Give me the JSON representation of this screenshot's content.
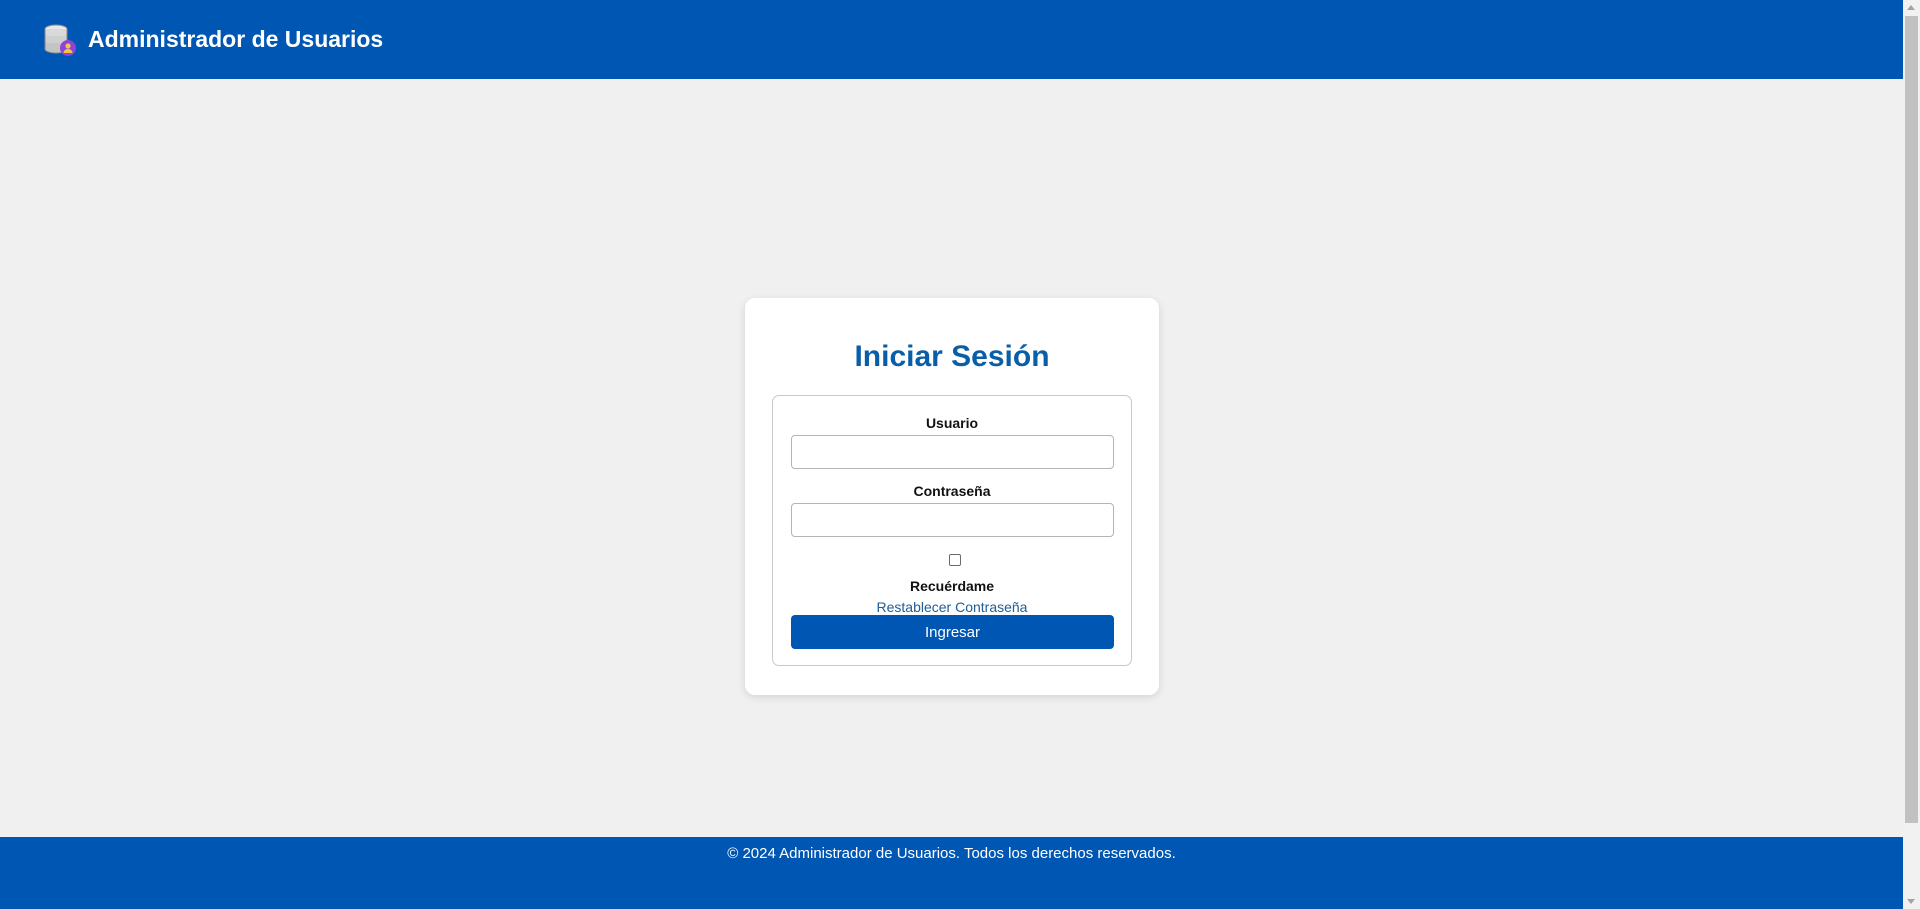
{
  "header": {
    "title": "Administrador de Usuarios",
    "logo_icon": "database-user-icon",
    "color": "#0057b3"
  },
  "login": {
    "title": "Iniciar Sesión",
    "username_label": "Usuario",
    "username_value": "",
    "password_label": "Contraseña",
    "password_value": "",
    "remember_label": "Recuérdame",
    "remember_checked": false,
    "reset_link": "Restablecer Contraseña",
    "submit_label": "Ingresar"
  },
  "footer": {
    "text": "© 2024 Administrador de Usuarios. Todos los derechos reservados."
  },
  "colors": {
    "primary": "#0057b3",
    "title": "#0a5ea8",
    "background": "#f0f0f0"
  }
}
